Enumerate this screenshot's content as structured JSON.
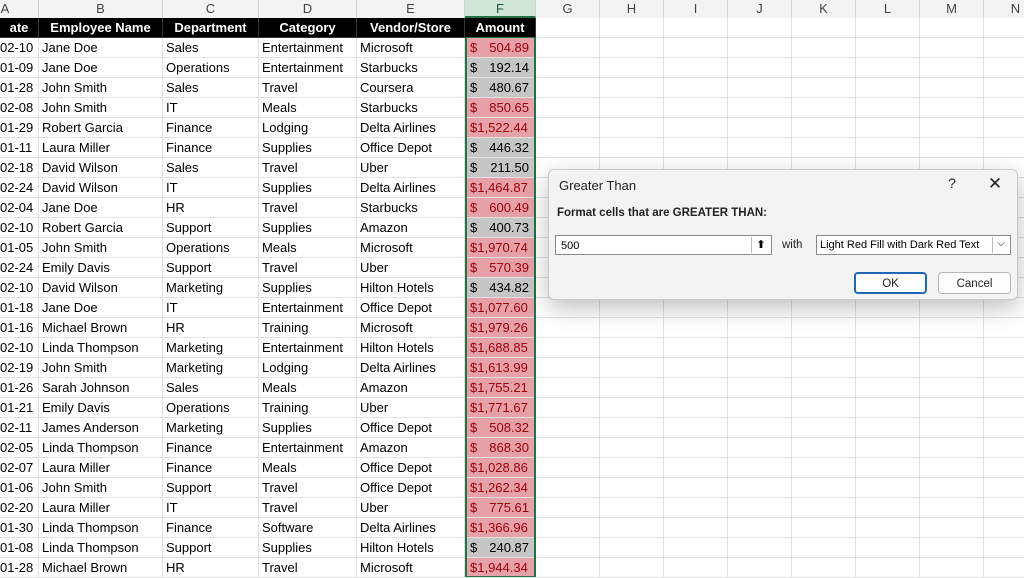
{
  "spreadsheet": {
    "column_headers": [
      "A",
      "B",
      "C",
      "D",
      "E",
      "F",
      "G",
      "H",
      "I",
      "J",
      "K",
      "L",
      "M",
      "N"
    ],
    "selected_column": "F",
    "table_headers": [
      "ate",
      "Employee Name",
      "Department",
      "Category",
      "Vendor/Store",
      "Amount"
    ],
    "rows": [
      {
        "date": "02-10",
        "name": "Jane Doe",
        "dept": "Sales",
        "cat": "Entertainment",
        "vendor": "Microsoft",
        "cur": "$",
        "amt": "504.89",
        "flag": "hi"
      },
      {
        "date": "01-09",
        "name": "Jane Doe",
        "dept": "Operations",
        "cat": "Entertainment",
        "vendor": "Starbucks",
        "cur": "$",
        "amt": "192.14",
        "flag": "lo"
      },
      {
        "date": "01-28",
        "name": "John Smith",
        "dept": "Sales",
        "cat": "Travel",
        "vendor": "Coursera",
        "cur": "$",
        "amt": "480.67",
        "flag": "lo"
      },
      {
        "date": "02-08",
        "name": "John Smith",
        "dept": "IT",
        "cat": "Meals",
        "vendor": "Starbucks",
        "cur": "$",
        "amt": "850.65",
        "flag": "hi"
      },
      {
        "date": "01-29",
        "name": "Robert Garcia",
        "dept": "Finance",
        "cat": "Lodging",
        "vendor": "Delta Airlines",
        "cur": "$1,522.44",
        "amt": "",
        "flag": "hi"
      },
      {
        "date": "01-11",
        "name": "Laura Miller",
        "dept": "Finance",
        "cat": "Supplies",
        "vendor": "Office Depot",
        "cur": "$",
        "amt": "446.32",
        "flag": "lo"
      },
      {
        "date": "02-18",
        "name": "David Wilson",
        "dept": "Sales",
        "cat": "Travel",
        "vendor": "Uber",
        "cur": "$",
        "amt": "211.50",
        "flag": "lo"
      },
      {
        "date": "02-24",
        "name": "David Wilson",
        "dept": "IT",
        "cat": "Supplies",
        "vendor": "Delta Airlines",
        "cur": "$1,464.87",
        "amt": "",
        "flag": "hi"
      },
      {
        "date": "02-04",
        "name": "Jane Doe",
        "dept": "HR",
        "cat": "Travel",
        "vendor": "Starbucks",
        "cur": "$",
        "amt": "600.49",
        "flag": "hi"
      },
      {
        "date": "02-10",
        "name": "Robert Garcia",
        "dept": "Support",
        "cat": "Supplies",
        "vendor": "Amazon",
        "cur": "$",
        "amt": "400.73",
        "flag": "lo"
      },
      {
        "date": "01-05",
        "name": "John Smith",
        "dept": "Operations",
        "cat": "Meals",
        "vendor": "Microsoft",
        "cur": "$1,970.74",
        "amt": "",
        "flag": "hi"
      },
      {
        "date": "02-24",
        "name": "Emily Davis",
        "dept": "Support",
        "cat": "Travel",
        "vendor": "Uber",
        "cur": "$",
        "amt": "570.39",
        "flag": "hi"
      },
      {
        "date": "02-10",
        "name": "David Wilson",
        "dept": "Marketing",
        "cat": "Supplies",
        "vendor": "Hilton Hotels",
        "cur": "$",
        "amt": "434.82",
        "flag": "lo"
      },
      {
        "date": "01-18",
        "name": "Jane Doe",
        "dept": "IT",
        "cat": "Entertainment",
        "vendor": "Office Depot",
        "cur": "$1,077.60",
        "amt": "",
        "flag": "hi"
      },
      {
        "date": "01-16",
        "name": "Michael Brown",
        "dept": "HR",
        "cat": "Training",
        "vendor": "Microsoft",
        "cur": "$1,979.26",
        "amt": "",
        "flag": "hi"
      },
      {
        "date": "02-10",
        "name": "Linda Thompson",
        "dept": "Marketing",
        "cat": "Entertainment",
        "vendor": "Hilton Hotels",
        "cur": "$1,688.85",
        "amt": "",
        "flag": "hi"
      },
      {
        "date": "02-19",
        "name": "John Smith",
        "dept": "Marketing",
        "cat": "Lodging",
        "vendor": "Delta Airlines",
        "cur": "$1,613.99",
        "amt": "",
        "flag": "hi"
      },
      {
        "date": "01-26",
        "name": "Sarah Johnson",
        "dept": "Sales",
        "cat": "Meals",
        "vendor": "Amazon",
        "cur": "$1,755.21",
        "amt": "",
        "flag": "hi"
      },
      {
        "date": "01-21",
        "name": "Emily Davis",
        "dept": "Operations",
        "cat": "Training",
        "vendor": "Uber",
        "cur": "$1,771.67",
        "amt": "",
        "flag": "hi"
      },
      {
        "date": "02-11",
        "name": "James Anderson",
        "dept": "Marketing",
        "cat": "Supplies",
        "vendor": "Office Depot",
        "cur": "$",
        "amt": "508.32",
        "flag": "hi"
      },
      {
        "date": "02-05",
        "name": "Linda Thompson",
        "dept": "Finance",
        "cat": "Entertainment",
        "vendor": "Amazon",
        "cur": "$",
        "amt": "868.30",
        "flag": "hi"
      },
      {
        "date": "02-07",
        "name": "Laura Miller",
        "dept": "Finance",
        "cat": "Meals",
        "vendor": "Office Depot",
        "cur": "$1,028.86",
        "amt": "",
        "flag": "hi"
      },
      {
        "date": "01-06",
        "name": "John Smith",
        "dept": "Support",
        "cat": "Travel",
        "vendor": "Office Depot",
        "cur": "$1,262.34",
        "amt": "",
        "flag": "hi"
      },
      {
        "date": "02-20",
        "name": "Laura Miller",
        "dept": "IT",
        "cat": "Travel",
        "vendor": "Uber",
        "cur": "$",
        "amt": "775.61",
        "flag": "hi"
      },
      {
        "date": "01-30",
        "name": "Linda Thompson",
        "dept": "Finance",
        "cat": "Software",
        "vendor": "Delta Airlines",
        "cur": "$1,366.96",
        "amt": "",
        "flag": "hi"
      },
      {
        "date": "01-08",
        "name": "Linda Thompson",
        "dept": "Support",
        "cat": "Supplies",
        "vendor": "Hilton Hotels",
        "cur": "$",
        "amt": "240.87",
        "flag": "lo"
      },
      {
        "date": "01-28",
        "name": "Michael Brown",
        "dept": "HR",
        "cat": "Travel",
        "vendor": "Microsoft",
        "cur": "$1,944.34",
        "amt": "",
        "flag": "hi"
      }
    ]
  },
  "dialog": {
    "title": "Greater Than",
    "help_glyph": "?",
    "close_glyph": "✕",
    "prompt": "Format cells that are GREATER THAN:",
    "value": "500",
    "with_label": "with",
    "format_option": "Light Red Fill with Dark Red Text",
    "ok_label": "OK",
    "cancel_label": "Cancel"
  },
  "colors": {
    "highlight_fill": "#e6a1a8",
    "highlight_text": "#9c0006",
    "selection_fill": "#c6c6c6",
    "selection_border": "#217346",
    "header_bg": "#000000",
    "ok_border": "#2066b8"
  }
}
